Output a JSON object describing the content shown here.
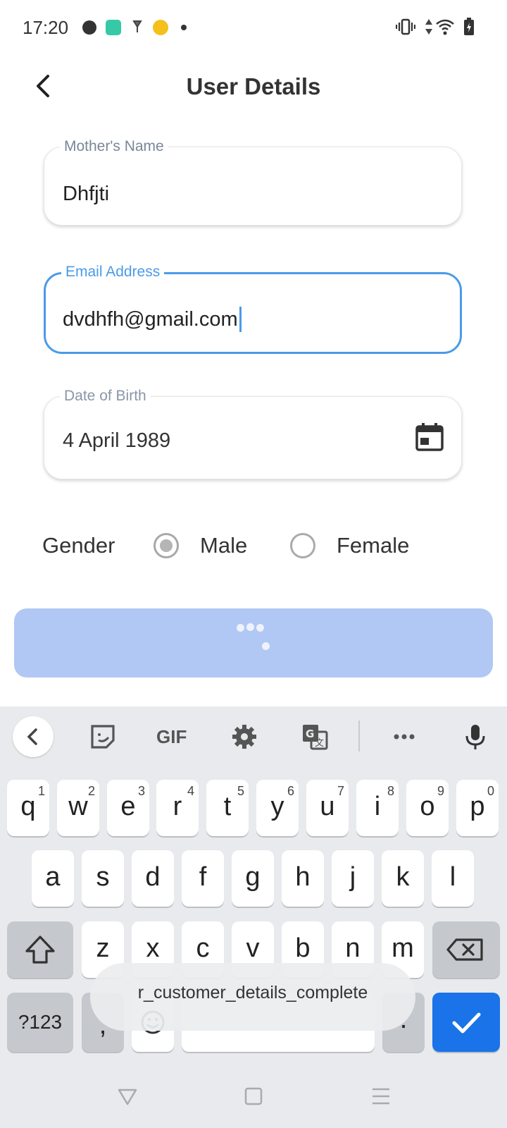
{
  "status_bar": {
    "time": "17:20",
    "icons": [
      "app-icon-1",
      "app-icon-2",
      "app-icon-3",
      "app-icon-4",
      "more-dot"
    ],
    "right_icons": [
      "vibrate-icon",
      "data-arrows-icon",
      "wifi-icon",
      "battery-icon"
    ]
  },
  "header": {
    "title": "User Details"
  },
  "form": {
    "mother_name": {
      "label": "Mother's Name",
      "value": "Dhfjti"
    },
    "email": {
      "label": "Email Address",
      "value": "dvdhfh@gmail.com"
    },
    "dob": {
      "label": "Date of Birth",
      "value": "4 April 1989"
    },
    "gender": {
      "label": "Gender",
      "options": [
        "Male",
        "Female"
      ],
      "selected": "Male"
    }
  },
  "keyboard": {
    "toolbar": [
      "back-icon",
      "sticker-icon",
      "gif-icon",
      "settings-icon",
      "translate-icon",
      "more-icon",
      "mic-icon"
    ],
    "gif_label": "GIF",
    "row1": [
      {
        "k": "q",
        "n": "1"
      },
      {
        "k": "w",
        "n": "2"
      },
      {
        "k": "e",
        "n": "3"
      },
      {
        "k": "r",
        "n": "4"
      },
      {
        "k": "t",
        "n": "5"
      },
      {
        "k": "y",
        "n": "6"
      },
      {
        "k": "u",
        "n": "7"
      },
      {
        "k": "i",
        "n": "8"
      },
      {
        "k": "o",
        "n": "9"
      },
      {
        "k": "p",
        "n": "0"
      }
    ],
    "row2": [
      "a",
      "s",
      "d",
      "f",
      "g",
      "h",
      "j",
      "k",
      "l"
    ],
    "row3": [
      "z",
      "x",
      "c",
      "v",
      "b",
      "n",
      "m"
    ],
    "symbols_label": "?123",
    "comma": ",",
    "period": "."
  },
  "toast": {
    "text": "r_customer_details_complete"
  },
  "colors": {
    "accent": "#4a9be8",
    "button": "#b0c8f3",
    "action": "#1a73e8"
  }
}
